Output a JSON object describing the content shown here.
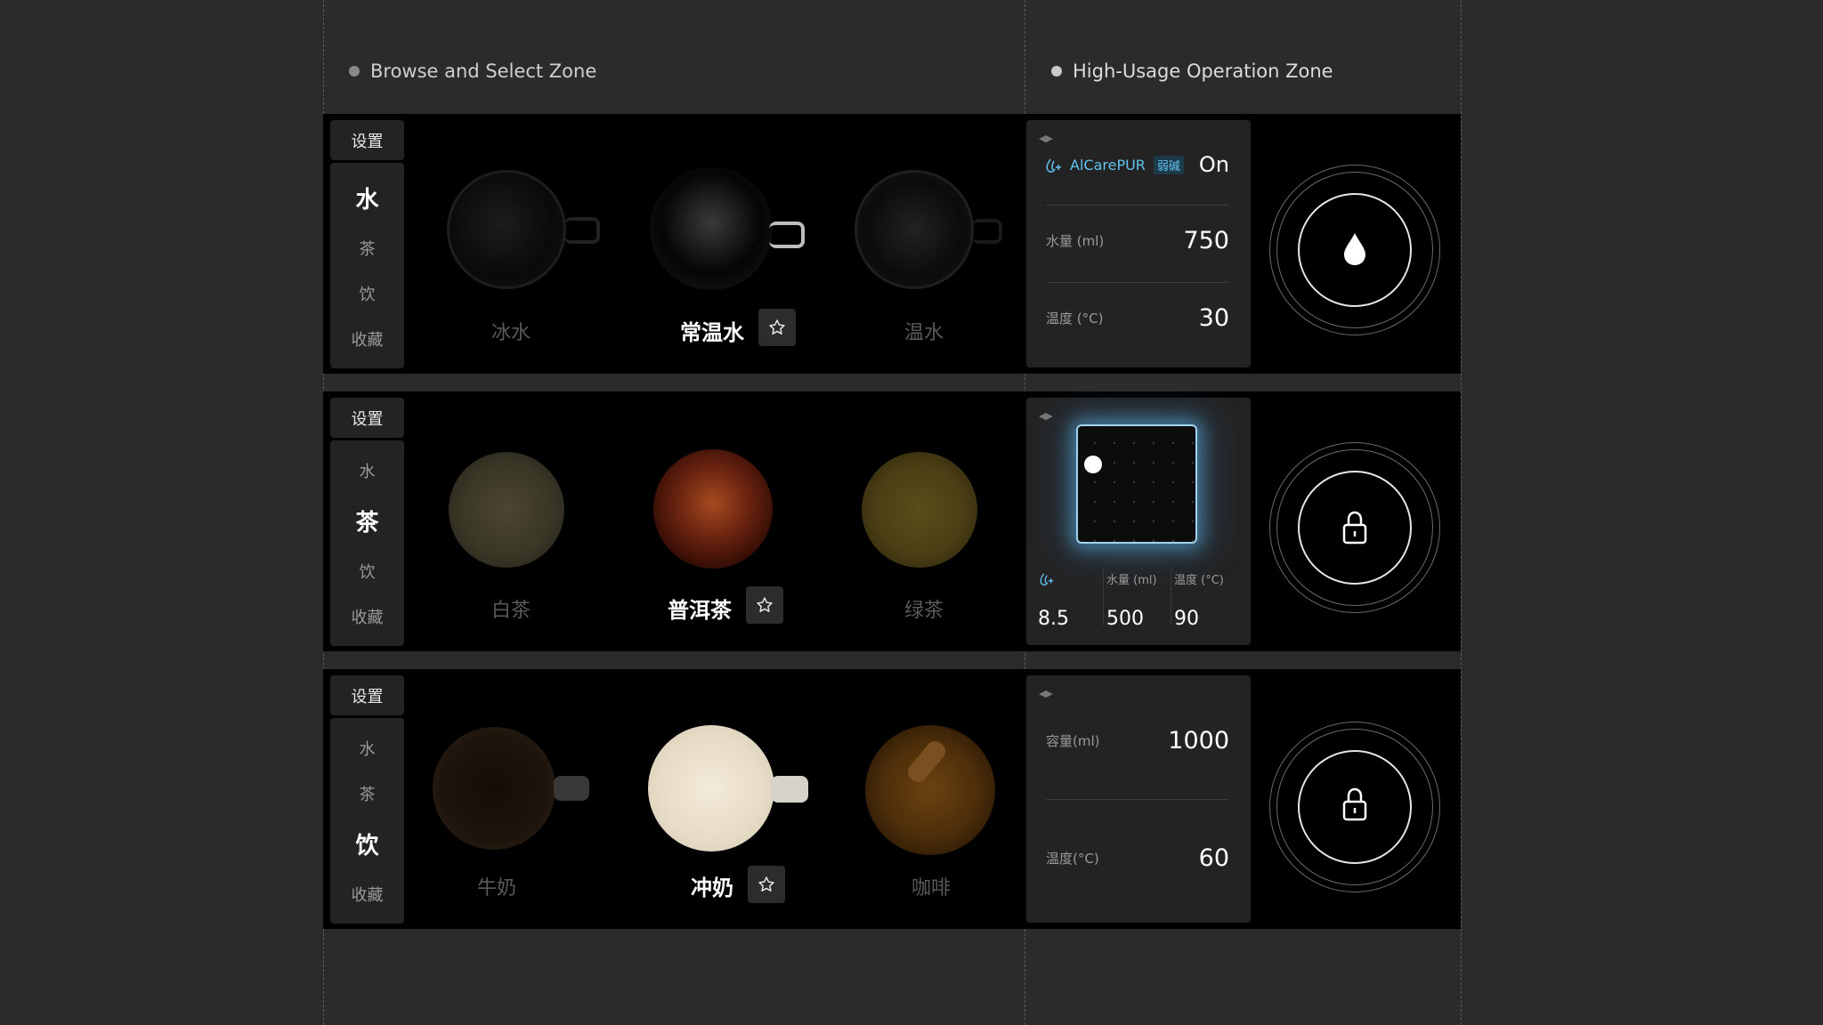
{
  "zones": {
    "browse_label": "Browse and Select Zone",
    "operation_label": "High-Usage Operation Zone"
  },
  "rows": [
    {
      "settings": "设置",
      "nav": [
        "水",
        "茶",
        "饮",
        "收藏"
      ],
      "active_nav": 0,
      "items": [
        "冰水",
        "常温水",
        "温水"
      ],
      "selected": 1,
      "panel": {
        "brand": "AlCarePUR",
        "badge": "弱碱",
        "status": "On",
        "r1_label": "水量 (ml)",
        "r1_value": "750",
        "r2_label": "温度 (°C)",
        "r2_value": "30"
      },
      "dial_icon": "water-drop-icon"
    },
    {
      "settings": "设置",
      "nav": [
        "水",
        "茶",
        "饮",
        "收藏"
      ],
      "active_nav": 1,
      "items": [
        "白茶",
        "普洱茶",
        "绿茶"
      ],
      "selected": 1,
      "panel": {
        "ph_value": "8.5",
        "vol_label": "水量 (ml)",
        "vol_value": "500",
        "temp_label": "温度 (°C)",
        "temp_value": "90"
      },
      "dial_icon": "lock-icon"
    },
    {
      "settings": "设置",
      "nav": [
        "水",
        "茶",
        "饮",
        "收藏"
      ],
      "active_nav": 2,
      "items": [
        "牛奶",
        "冲奶",
        "咖啡"
      ],
      "selected": 1,
      "panel": {
        "r1_label": "容量(ml)",
        "r1_value": "1000",
        "r2_label": "温度(°C)",
        "r2_value": "60"
      },
      "dial_icon": "lock-icon"
    }
  ]
}
